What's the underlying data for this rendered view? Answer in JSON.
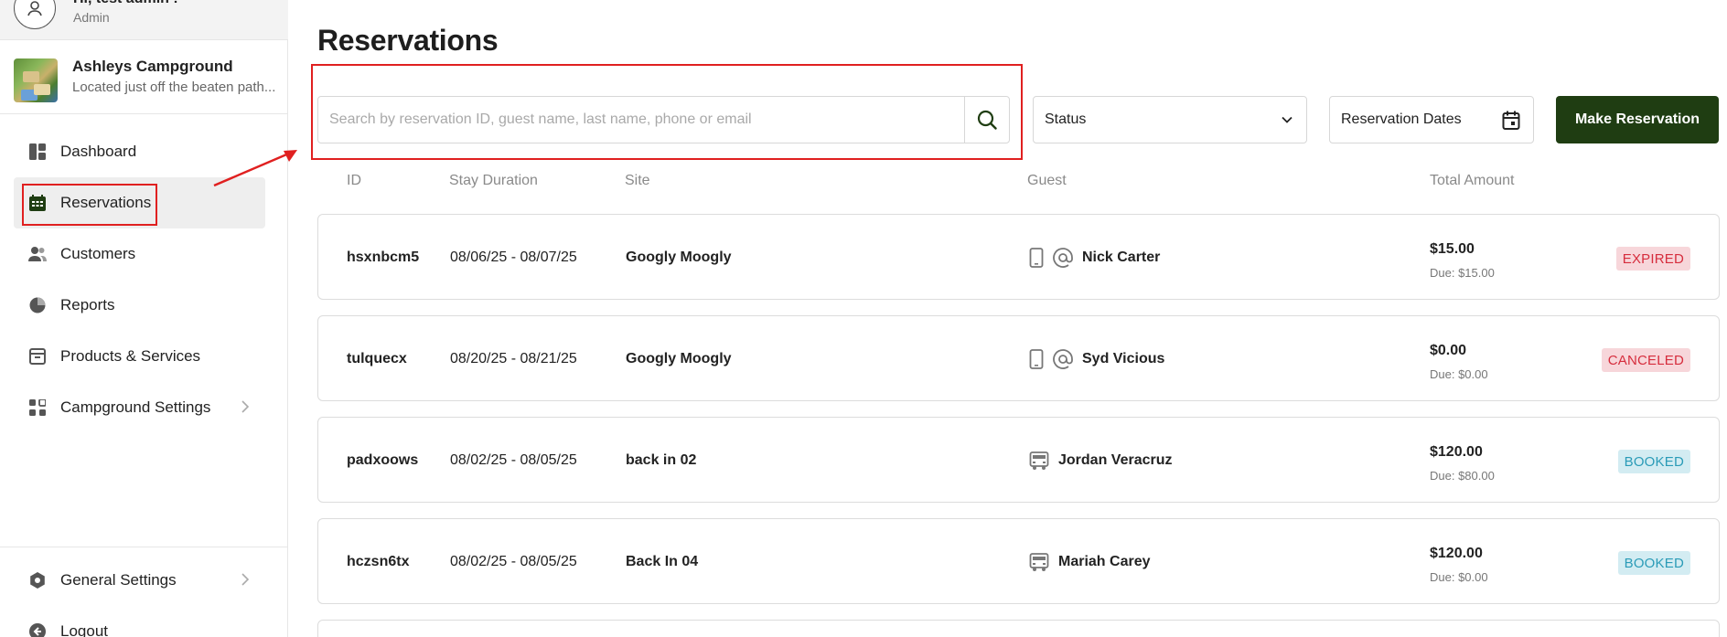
{
  "user": {
    "greeting": "Hi, test admin !",
    "role": "Admin"
  },
  "campground": {
    "name": "Ashleys Campground",
    "tagline": "Located just off the beaten path..."
  },
  "nav": {
    "dashboard": "Dashboard",
    "reservations": "Reservations",
    "customers": "Customers",
    "reports": "Reports",
    "products": "Products & Services",
    "campground_settings": "Campground Settings",
    "general_settings": "General Settings",
    "logout": "Logout"
  },
  "page": {
    "title": "Reservations"
  },
  "toolbar": {
    "search_placeholder": "Search by reservation ID, guest name, last name, phone or email",
    "status_label": "Status",
    "dates_label": "Reservation Dates",
    "make_label": "Make Reservation"
  },
  "table": {
    "headers": {
      "id": "ID",
      "duration": "Stay Duration",
      "site": "Site",
      "guest": "Guest",
      "total": "Total Amount"
    },
    "rows": [
      {
        "id": "hsxnbcm5",
        "duration": "08/06/25  -  08/07/25",
        "site": "Googly Moogly",
        "guest": "Nick Carter",
        "amount": "$15.00",
        "due": "Due: $15.00",
        "status": "EXPIRED"
      },
      {
        "id": "tulquecx",
        "duration": "08/20/25  -  08/21/25",
        "site": "Googly Moogly",
        "guest": "Syd Vicious",
        "amount": "$0.00",
        "due": "Due: $0.00",
        "status": "CANCELED"
      },
      {
        "id": "padxoows",
        "duration": "08/02/25  -  08/05/25",
        "site": "back in 02",
        "guest": "Jordan Veracruz",
        "amount": "$120.00",
        "due": "Due: $80.00",
        "status": "BOOKED"
      },
      {
        "id": "hczsn6tx",
        "duration": "08/02/25  -  08/05/25",
        "site": "Back In 04",
        "guest": "Mariah Carey",
        "amount": "$120.00",
        "due": "Due: $0.00",
        "status": "BOOKED"
      }
    ]
  },
  "icons": {
    "user": "user-icon",
    "dashboard": "dashboard-icon",
    "reservations": "calendar-icon",
    "customers": "customers-icon",
    "reports": "pie-chart-icon",
    "products": "box-icon",
    "campground_settings": "grid-icon",
    "general_settings": "gear-icon",
    "logout": "logout-icon",
    "search": "search-icon",
    "chevron": "chevron-down-icon",
    "calendar": "calendar-icon",
    "phone": "phone-icon",
    "email": "at-icon",
    "rv": "rv-icon"
  },
  "colors": {
    "primary": "#1f3d12",
    "annotation": "#e02020",
    "expired": "#d62d3d",
    "booked": "#2a9bb7"
  }
}
